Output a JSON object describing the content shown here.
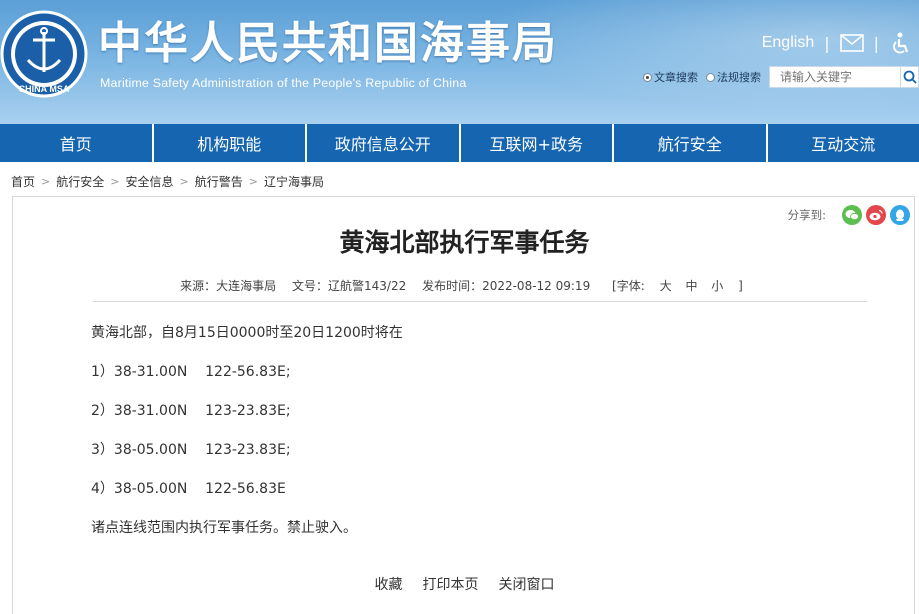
{
  "header": {
    "site_title": "中华人民共和国海事局",
    "site_subtitle": "Maritime Safety Administration of the People's Republic of China",
    "logo_text": "CHINA MSA",
    "english_link": "English",
    "icons": [
      "mail-icon",
      "accessibility-icon"
    ],
    "search": {
      "options": [
        "文章搜索",
        "法规搜索"
      ],
      "selected": "文章搜索",
      "placeholder": "请输入关键字"
    }
  },
  "nav": {
    "items": [
      "首页",
      "机构职能",
      "政府信息公开",
      "互联网+政务",
      "航行安全",
      "互动交流"
    ]
  },
  "breadcrumb": [
    "首页",
    "航行安全",
    "安全信息",
    "航行警告",
    "辽宁海事局"
  ],
  "article": {
    "share_label": "分享到:",
    "share_icons": [
      "wechat-icon",
      "weibo-icon",
      "qq-icon"
    ],
    "title": "黄海北部执行军事任务",
    "source": "来源：大连海事局",
    "doc_no": "文号：辽航警143/22",
    "publish_time": "发布时间：2022-08-12 09:19",
    "font_size": {
      "open": "[字体:",
      "large": "大",
      "medium": "中",
      "small": "小",
      "close": "]"
    },
    "body": [
      "黄海北部，自8月15日0000时至20日1200时将在",
      "1）38-31.00N    122-56.83E;",
      "2）38-31.00N    123-23.83E;",
      "3）38-05.00N    123-23.83E;",
      "4）38-05.00N    122-56.83E",
      "诸点连线范围内执行军事任务。禁止驶入。"
    ],
    "actions": [
      "收藏",
      "打印本页",
      "关闭窗口"
    ]
  },
  "colors": {
    "nav_bg": "#1565b0",
    "header_top": "#5b9fd6",
    "wechat": "#5bbf4f",
    "weibo": "#e2474b",
    "qq": "#33a6e8"
  }
}
